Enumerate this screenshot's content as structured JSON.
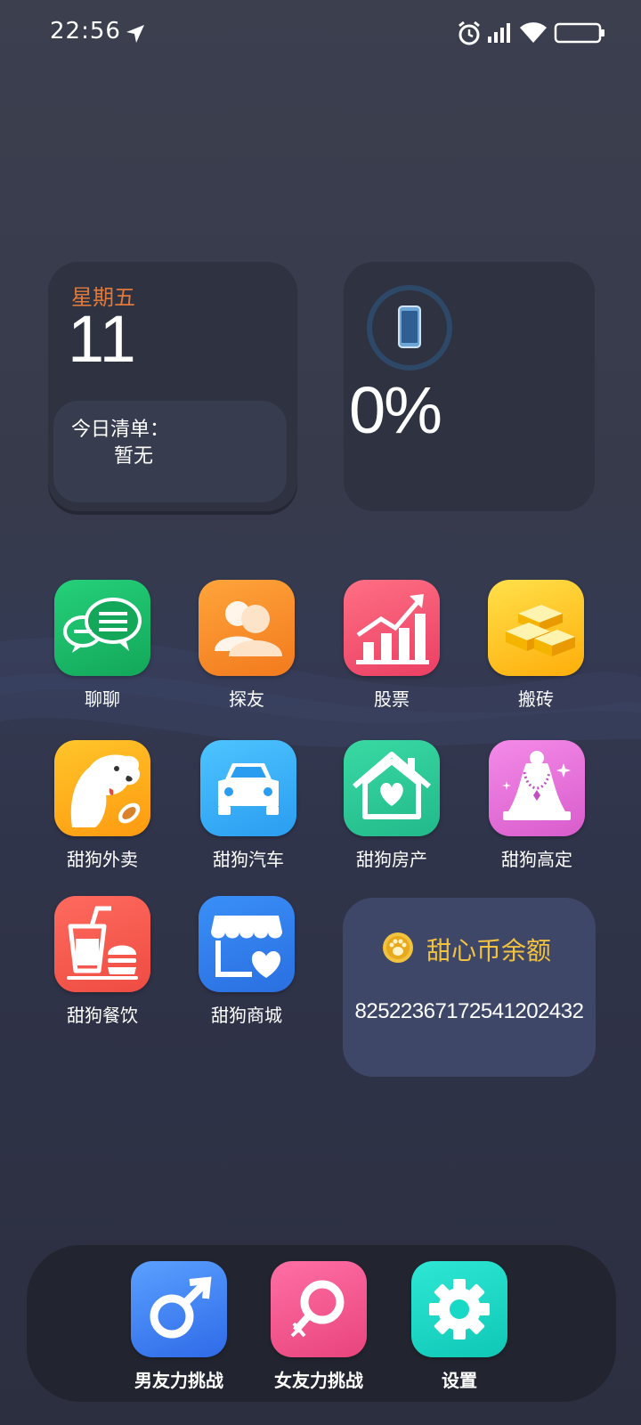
{
  "status_bar": {
    "time": "22:56",
    "icons": [
      "location-arrow-icon",
      "alarm-icon",
      "signal-icon",
      "wifi-icon",
      "battery-icon"
    ]
  },
  "date_widget": {
    "weekday": "星期五",
    "day": "11",
    "todo_title": "今日清单：",
    "todo_value": "暂无"
  },
  "battery_widget": {
    "percent": "0%",
    "icon": "phone-icon"
  },
  "coin_widget": {
    "title": "甜心币余额",
    "amount": "8252236717254120243​2",
    "icon": "paw-coin-icon"
  },
  "apps": [
    {
      "label": "聊聊",
      "icon": "chat-icon",
      "color": "#1fbf6b"
    },
    {
      "label": "探友",
      "icon": "friends-icon",
      "color": "#f7892a"
    },
    {
      "label": "股票",
      "icon": "stocks-icon",
      "color": "#f0546e"
    },
    {
      "label": "搬砖",
      "icon": "gold-bars-icon",
      "color": "#ffc21a"
    },
    {
      "label": "甜狗外卖",
      "icon": "dog-icon",
      "color": "#ffb21a"
    },
    {
      "label": "甜狗汽车",
      "icon": "car-icon",
      "color": "#3ab3f7"
    },
    {
      "label": "甜狗房产",
      "icon": "house-icon",
      "color": "#2fcf9a"
    },
    {
      "label": "甜狗高定",
      "icon": "jewelry-icon",
      "color": "#e86fd8"
    },
    {
      "label": "甜狗餐饮",
      "icon": "food-icon",
      "color": "#f5584e"
    },
    {
      "label": "甜狗商城",
      "icon": "shop-icon",
      "color": "#2f7ff0"
    }
  ],
  "dock": [
    {
      "label": "男友力挑战",
      "icon": "male-symbol-icon",
      "color": "#3d7cf2"
    },
    {
      "label": "女友力挑战",
      "icon": "female-symbol-icon",
      "color": "#f0558e"
    },
    {
      "label": "设置",
      "icon": "gear-icon",
      "color": "#18d8c6"
    }
  ]
}
